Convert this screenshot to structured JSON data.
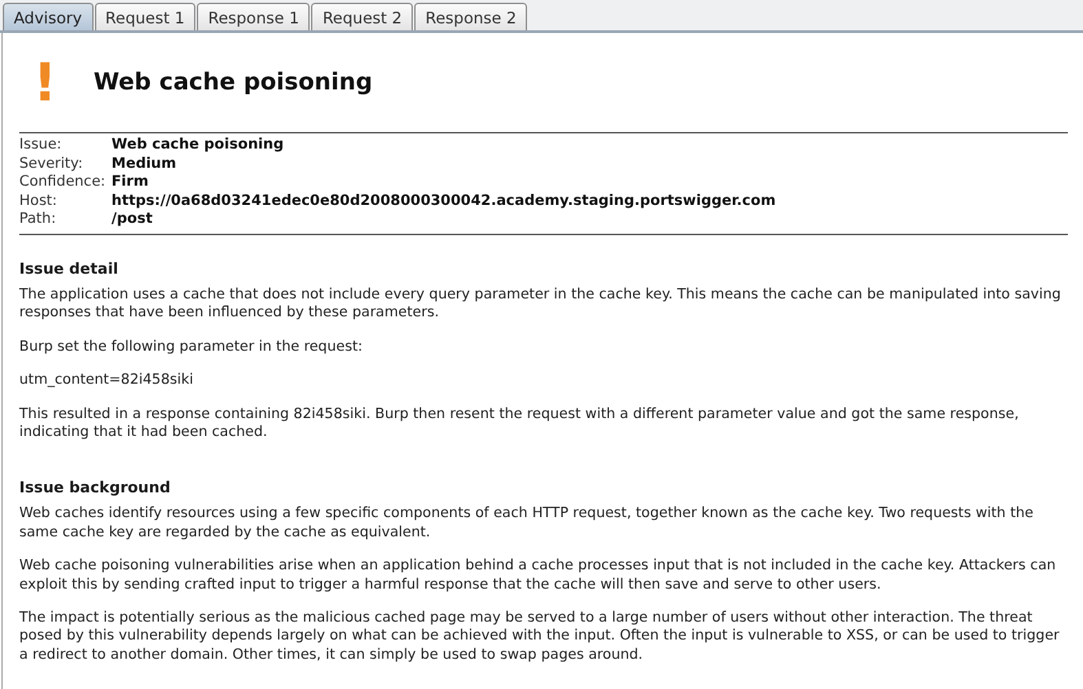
{
  "tabs": [
    {
      "label": "Advisory",
      "selected": true
    },
    {
      "label": "Request 1",
      "selected": false
    },
    {
      "label": "Response 1",
      "selected": false
    },
    {
      "label": "Request 2",
      "selected": false
    },
    {
      "label": "Response 2",
      "selected": false
    }
  ],
  "advisory": {
    "icon": "!",
    "title": "Web cache poisoning",
    "details": [
      {
        "label": "Issue:",
        "value": "Web cache poisoning"
      },
      {
        "label": "Severity:",
        "value": "Medium"
      },
      {
        "label": "Confidence:",
        "value": "Firm"
      },
      {
        "label": "Host:",
        "value": "https://0a68d03241edec0e80d2008000300042.academy.staging.portswigger.com"
      },
      {
        "label": "Path:",
        "value": "/post"
      }
    ],
    "sections": [
      {
        "heading": "Issue detail",
        "paragraphs": [
          "The application uses a cache that does not include every query parameter in the cache key. This means the cache can be manipulated into saving responses that have been influenced by these parameters.",
          "Burp set the following parameter in the request:",
          "utm_content=82i458siki",
          "This resulted in a response containing 82i458siki. Burp then resent the request with a different parameter value and got the same response, indicating that it had been cached."
        ]
      },
      {
        "heading": "Issue background",
        "paragraphs": [
          "Web caches identify resources using a few specific components of each HTTP request, together known as the cache key. Two requests with the same cache key are regarded by the cache as equivalent.",
          "Web cache poisoning vulnerabilities arise when an application behind a cache processes input that is not included in the cache key. Attackers can exploit this by sending crafted input to trigger a harmful response that the cache will then save and serve to other users.",
          "The impact is potentially serious as the malicious cached page may be served to a large number of users without other interaction. The threat posed by this vulnerability depends largely on what can be achieved with the input. Often the input is vulnerable to XSS, or can be used to trigger a redirect to another domain. Other times, it can simply be used to swap pages around."
        ]
      }
    ]
  }
}
